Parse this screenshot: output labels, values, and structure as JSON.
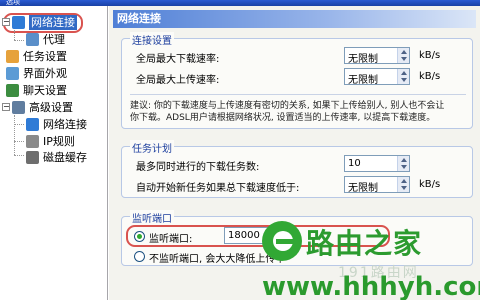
{
  "window": {
    "title": "选项"
  },
  "tree": {
    "items": [
      {
        "label": "网络连接",
        "icon": "network-globe-icon",
        "color": "#2f7bd6"
      },
      {
        "label": "代理",
        "icon": "proxy-computer-icon",
        "color": "#5a8fc9"
      },
      {
        "label": "任务设置",
        "icon": "task-folder-icon",
        "color": "#e6a23c"
      },
      {
        "label": "界面外观",
        "icon": "appearance-palette-icon",
        "color": "#5b9bd5"
      },
      {
        "label": "聊天设置",
        "icon": "chat-people-icon",
        "color": "#3c8d40"
      },
      {
        "label": "高级设置",
        "icon": "advanced-settings-icon",
        "color": "#607d9f"
      },
      {
        "label": "网络连接",
        "icon": "network-globe-icon",
        "color": "#2f7bd6"
      },
      {
        "label": "IP规则",
        "icon": "ip-rules-icon",
        "color": "#8a8a8a"
      },
      {
        "label": "磁盘缓存",
        "icon": "disk-cache-icon",
        "color": "#6e6e6e"
      }
    ]
  },
  "panel": {
    "title": "网络连接",
    "connection": {
      "title": "连接设置",
      "max_download_label": "全局最大下载速率:",
      "max_download_value": "无限制",
      "max_upload_label": "全局最大上传速率:",
      "max_upload_value": "无限制",
      "unit": "kB/s",
      "note_line1": "建议: 你的下载速度与上传速度有密切的关系, 如果下上传给别人, 别人也不会让",
      "note_line2": "你下载。ADSL用户请根据网络状况, 设置适当的上传速率, 以提高下载速度。"
    },
    "task": {
      "title": "任务计划",
      "max_tasks_label": "最多同时进行的下载任务数:",
      "max_tasks_value": "10",
      "auto_start_label": "自动开始新任务如果总下载速度低于:",
      "auto_start_value": "无限制",
      "unit": "kB/s"
    },
    "listen": {
      "title": "监听端口",
      "port_label": "监听端口:",
      "port_value": "18000",
      "no_listen_label": "不监听端口, 会大大降低上传下"
    }
  },
  "watermark": {
    "text": "路由之家",
    "sub": "191路由网",
    "url": "www.hhhyh.com"
  }
}
